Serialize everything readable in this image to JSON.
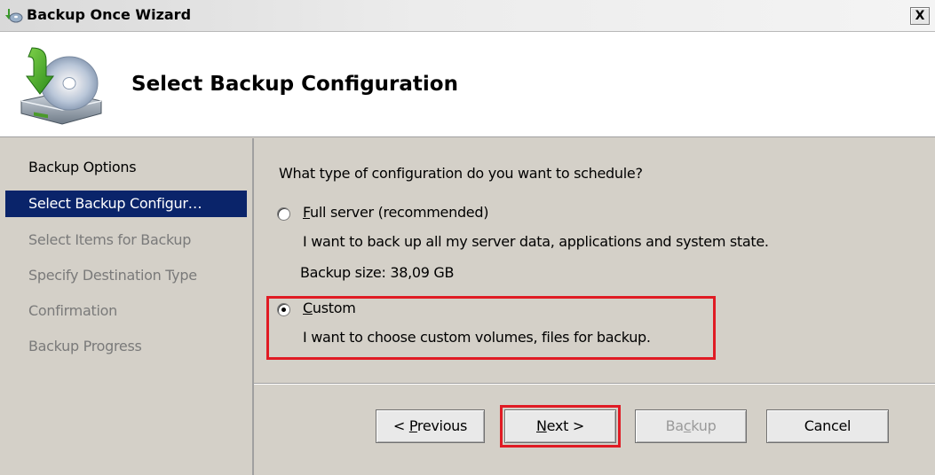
{
  "window": {
    "title": "Backup Once Wizard",
    "close_label": "X"
  },
  "header": {
    "title": "Select Backup Configuration"
  },
  "nav": {
    "items": [
      {
        "label": "Backup Options",
        "state": "normal"
      },
      {
        "label": "Select Backup Configur…",
        "state": "active"
      },
      {
        "label": "Select Items for Backup",
        "state": "disabled"
      },
      {
        "label": "Specify Destination Type",
        "state": "disabled"
      },
      {
        "label": "Confirmation",
        "state": "disabled"
      },
      {
        "label": "Backup Progress",
        "state": "disabled"
      }
    ]
  },
  "main": {
    "question": "What type of configuration do you want to schedule?",
    "full_server": {
      "label_first": "F",
      "label_rest": "ull server (recommended)",
      "description": "I want to back up all my server data, applications and system state.",
      "size": "Backup size: 38,09 GB",
      "selected": false
    },
    "custom": {
      "label_first": "C",
      "label_rest": "ustom",
      "description": "I want to choose custom volumes, files for backup.",
      "selected": true
    }
  },
  "buttons": {
    "previous_prefix": "< ",
    "previous_accel": "P",
    "previous_rest": "revious",
    "next_accel": "N",
    "next_rest": "ext >",
    "backup_pre": "Ba",
    "backup_accel": "c",
    "backup_rest": "kup",
    "cancel": "Cancel"
  },
  "colors": {
    "highlight": "#e01b24",
    "selection": "#0a246a",
    "dialog_bg": "#d4d0c8"
  }
}
